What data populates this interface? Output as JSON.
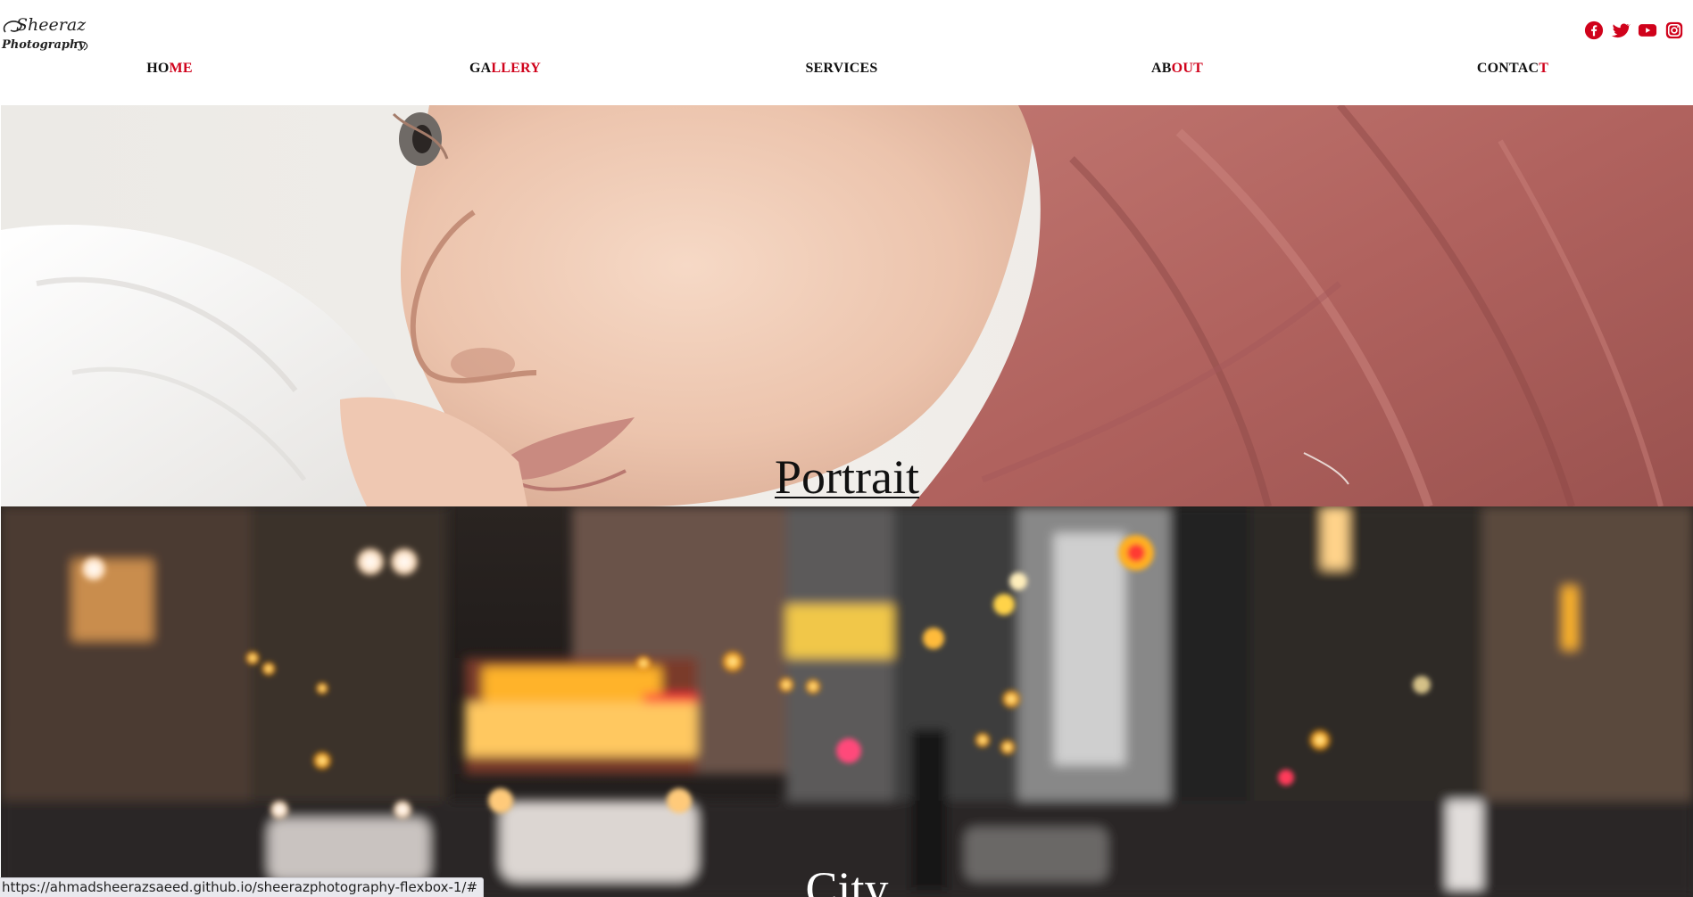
{
  "brand": {
    "logo_text_line1": "Sheeraz",
    "logo_text_line2": "Photography"
  },
  "nav": {
    "items": [
      {
        "label_dark": "HO",
        "label_red": "ME"
      },
      {
        "label_dark": "GA",
        "label_red": "LLERY"
      },
      {
        "label_dark": "SERVICES",
        "label_red": ""
      },
      {
        "label_dark": "AB",
        "label_red": "OUT"
      },
      {
        "label_dark": "CONTAC",
        "label_red": "T"
      }
    ]
  },
  "social": {
    "icons": [
      "facebook-icon",
      "twitter-icon",
      "youtube-icon",
      "instagram-icon"
    ],
    "color": "#d0021b"
  },
  "gallery": {
    "sections": [
      {
        "caption": "Portrait"
      },
      {
        "caption": "City"
      }
    ]
  },
  "status_bar": {
    "url": "https://ahmadsheerazsaeed.github.io/sheerazphotography-flexbox-1/#"
  },
  "colors": {
    "accent": "#d0021b",
    "text": "#111111",
    "background": "#ffffff"
  }
}
